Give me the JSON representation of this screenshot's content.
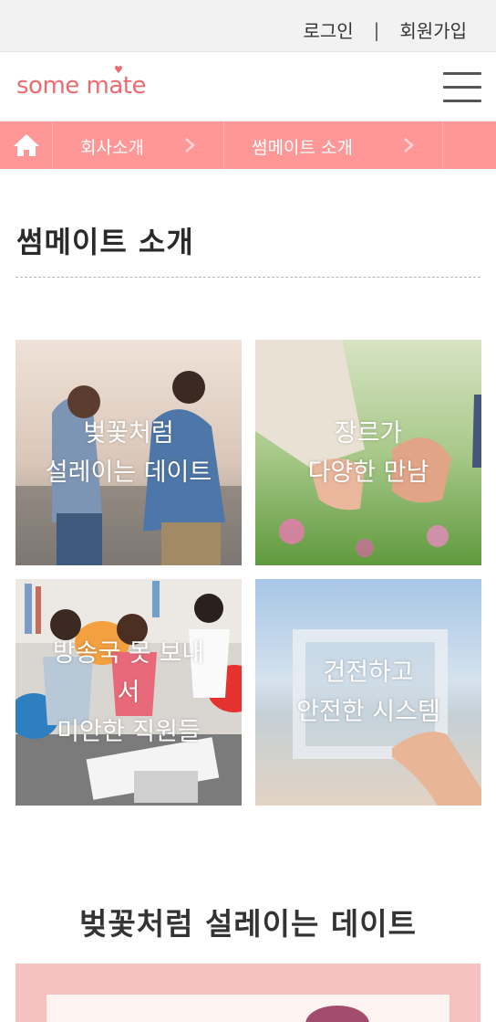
{
  "topbar": {
    "login": "로그인",
    "separator": "|",
    "signup": "회원가입"
  },
  "header": {
    "logo": "some mate",
    "menu_icon": "hamburger-menu-icon"
  },
  "breadcrumb": {
    "home_icon": "home-icon",
    "items": [
      "회사소개",
      "썸메이트 소개"
    ],
    "colors": {
      "bar": "#ff9797",
      "text": "#ffffff"
    }
  },
  "page": {
    "title": "썸메이트 소개"
  },
  "tiles": [
    {
      "line1": "벚꽃처럼",
      "line2": "설레이는 데이트",
      "line3": ""
    },
    {
      "line1": "장르가",
      "line2": "다양한 만남",
      "line3": ""
    },
    {
      "line1": "방송국 못 보내",
      "line2": "서",
      "line3": "미안한 직원들"
    },
    {
      "line1": "건전하고",
      "line2": "안전한 시스템",
      "line3": ""
    }
  ],
  "section": {
    "title": "벚꽃처럼 설레이는 데이트"
  },
  "theme": {
    "accent": "#f0696f",
    "breadcrumb": "#ff9797"
  }
}
